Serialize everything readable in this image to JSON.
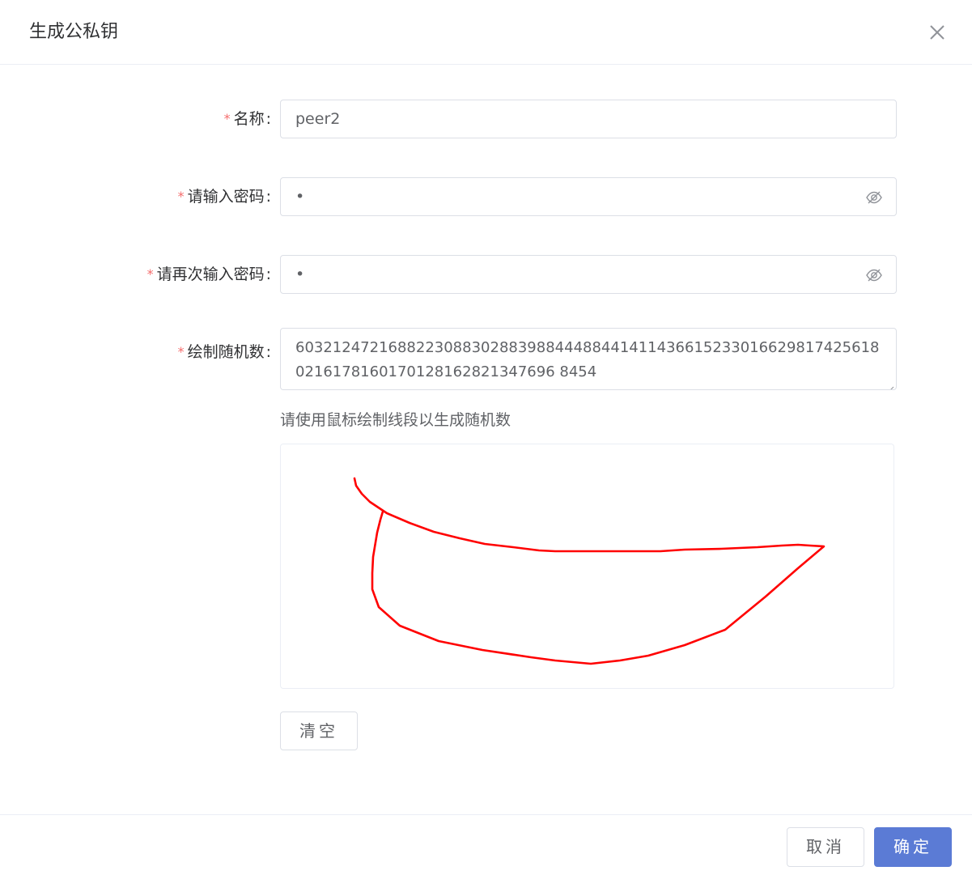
{
  "dialog": {
    "title": "生成公私钥",
    "close_icon": "close-icon"
  },
  "form": {
    "required_mark": "*",
    "colon": ":",
    "name": {
      "label": "名称",
      "value": "peer2"
    },
    "password": {
      "label": "请输入密码",
      "value": "•",
      "toggle_icon": "eye-off-icon"
    },
    "password_confirm": {
      "label": "请再次输入密码",
      "value": "•",
      "toggle_icon": "eye-off-icon"
    },
    "random": {
      "label": "绘制随机数",
      "value": "6032124721688223088302883988444884414114366152330166298174256180216178160170128162821347696 8454"
    },
    "hint": "请使用鼠标绘制线段以生成随机数",
    "clear_label": "清空"
  },
  "footer": {
    "cancel_label": "取消",
    "confirm_label": "确定"
  },
  "colors": {
    "primary": "#5b7bd5",
    "required": "#f56c6c",
    "stroke": "#ff0000"
  }
}
